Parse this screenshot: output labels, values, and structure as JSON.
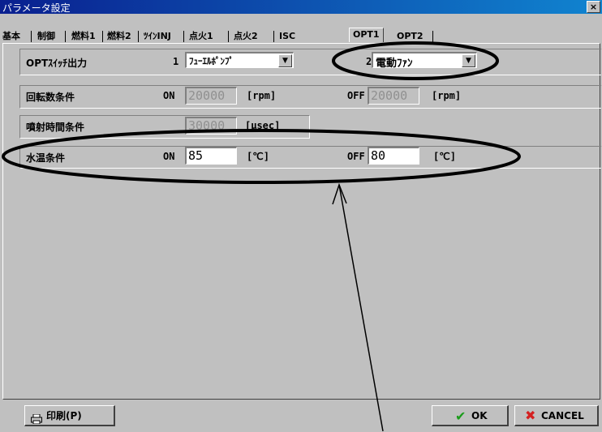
{
  "window": {
    "title": "パラメータ設定",
    "close_glyph": "×"
  },
  "tabs": [
    {
      "label": "基本"
    },
    {
      "label": "制御"
    },
    {
      "label": "燃料1"
    },
    {
      "label": "燃料2"
    },
    {
      "label": "ﾂｲﾝINJ"
    },
    {
      "label": "点火1"
    },
    {
      "label": "点火2"
    },
    {
      "label": "ISC"
    },
    {
      "label": "OPT1",
      "active": true
    },
    {
      "label": "OPT2"
    }
  ],
  "opt_switch": {
    "label": "OPTｽｲｯﾁ出力",
    "num1": "1",
    "value1": "ﾌｭｰｴﾙﾎﾟﾝﾌﾟ",
    "num2": "2",
    "value2": "電動ﾌｧﾝ"
  },
  "rpm": {
    "label": "回転数条件",
    "on_label": "ON",
    "on_value": "20000",
    "unit": "[rpm]",
    "off_label": "OFF",
    "off_value": "20000",
    "off_unit": "[rpm]"
  },
  "inj": {
    "label": "噴射時間条件",
    "value": "30000",
    "unit": "[μsec]"
  },
  "water": {
    "label": "水温条件",
    "on_label": "ON",
    "on_value": "85",
    "unit": "[℃]",
    "off_label": "OFF",
    "off_value": "80",
    "off_unit": "[℃]"
  },
  "buttons": {
    "print": "印刷(P)",
    "ok": "OK",
    "cancel": "CANCEL"
  },
  "icons": {
    "printer": "printer-icon",
    "ok": "check-icon",
    "cancel": "x-icon"
  },
  "colors": {
    "title_bar": "#0a1f8f",
    "ok_green": "#1a9c1a",
    "cancel_red": "#d42020"
  }
}
